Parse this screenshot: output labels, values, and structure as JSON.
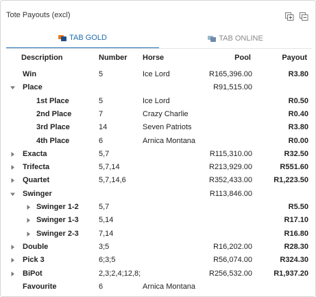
{
  "panel": {
    "title": "Tote Payouts (excl)",
    "icons": [
      "expand-all-icon",
      "collapse-all-icon"
    ]
  },
  "tabs": [
    {
      "label": "TAB GOLD",
      "active": true,
      "icon": "tab-gold-logo-icon"
    },
    {
      "label": "TAB ONLINE",
      "active": false,
      "icon": "tab-online-logo-icon"
    }
  ],
  "columns": {
    "description": "Description",
    "number": "Number",
    "horse": "Horse",
    "pool": "Pool",
    "payout": "Payout"
  },
  "rows": [
    {
      "level": 0,
      "toggle": "none",
      "description": "Win",
      "number": "5",
      "horse": "Ice Lord",
      "pool": "R165,396.00",
      "payout": "R3.80"
    },
    {
      "level": 0,
      "toggle": "expanded",
      "description": "Place",
      "number": "",
      "horse": "",
      "pool": "R91,515.00",
      "payout": ""
    },
    {
      "level": 1,
      "toggle": "none",
      "description": "1st Place",
      "number": "5",
      "horse": "Ice Lord",
      "pool": "",
      "payout": "R0.50"
    },
    {
      "level": 1,
      "toggle": "none",
      "description": "2nd Place",
      "number": "7",
      "horse": "Crazy Charlie",
      "pool": "",
      "payout": "R0.40"
    },
    {
      "level": 1,
      "toggle": "none",
      "description": "3rd Place",
      "number": "14",
      "horse": "Seven Patriots",
      "pool": "",
      "payout": "R3.80"
    },
    {
      "level": 1,
      "toggle": "none",
      "description": "4th Place",
      "number": "6",
      "horse": "Arnica Montana",
      "pool": "",
      "payout": "R0.00"
    },
    {
      "level": 0,
      "toggle": "collapsed",
      "description": "Exacta",
      "number": "5,7",
      "horse": "",
      "pool": "R115,310.00",
      "payout": "R32.50"
    },
    {
      "level": 0,
      "toggle": "collapsed",
      "description": "Trifecta",
      "number": "5,7,14",
      "horse": "",
      "pool": "R213,929.00",
      "payout": "R551.60"
    },
    {
      "level": 0,
      "toggle": "collapsed",
      "description": "Quartet",
      "number": "5,7,14,6",
      "horse": "",
      "pool": "R352,433.00",
      "payout": "R1,223.50"
    },
    {
      "level": 0,
      "toggle": "expanded",
      "description": "Swinger",
      "number": "",
      "horse": "",
      "pool": "R113,846.00",
      "payout": ""
    },
    {
      "level": 1,
      "toggle": "collapsed",
      "description": "Swinger 1-2",
      "number": "5,7",
      "horse": "",
      "pool": "",
      "payout": "R5.50"
    },
    {
      "level": 1,
      "toggle": "collapsed",
      "description": "Swinger 1-3",
      "number": "5,14",
      "horse": "",
      "pool": "",
      "payout": "R17.10"
    },
    {
      "level": 1,
      "toggle": "collapsed",
      "description": "Swinger 2-3",
      "number": "7,14",
      "horse": "",
      "pool": "",
      "payout": "R16.80"
    },
    {
      "level": 0,
      "toggle": "collapsed",
      "description": "Double",
      "number": "3;5",
      "horse": "",
      "pool": "R16,202.00",
      "payout": "R28.30"
    },
    {
      "level": 0,
      "toggle": "collapsed",
      "description": "Pick 3",
      "number": "6;3;5",
      "horse": "",
      "pool": "R56,074.00",
      "payout": "R324.30"
    },
    {
      "level": 0,
      "toggle": "collapsed",
      "description": "BiPot",
      "number": "2,3;2,4;12,8;",
      "horse": "",
      "pool": "R256,532.00",
      "payout": "R1,937.20"
    },
    {
      "level": 0,
      "toggle": "none",
      "description": "Favourite",
      "number": "6",
      "horse": "Arnica Montana",
      "pool": "",
      "payout": ""
    }
  ]
}
